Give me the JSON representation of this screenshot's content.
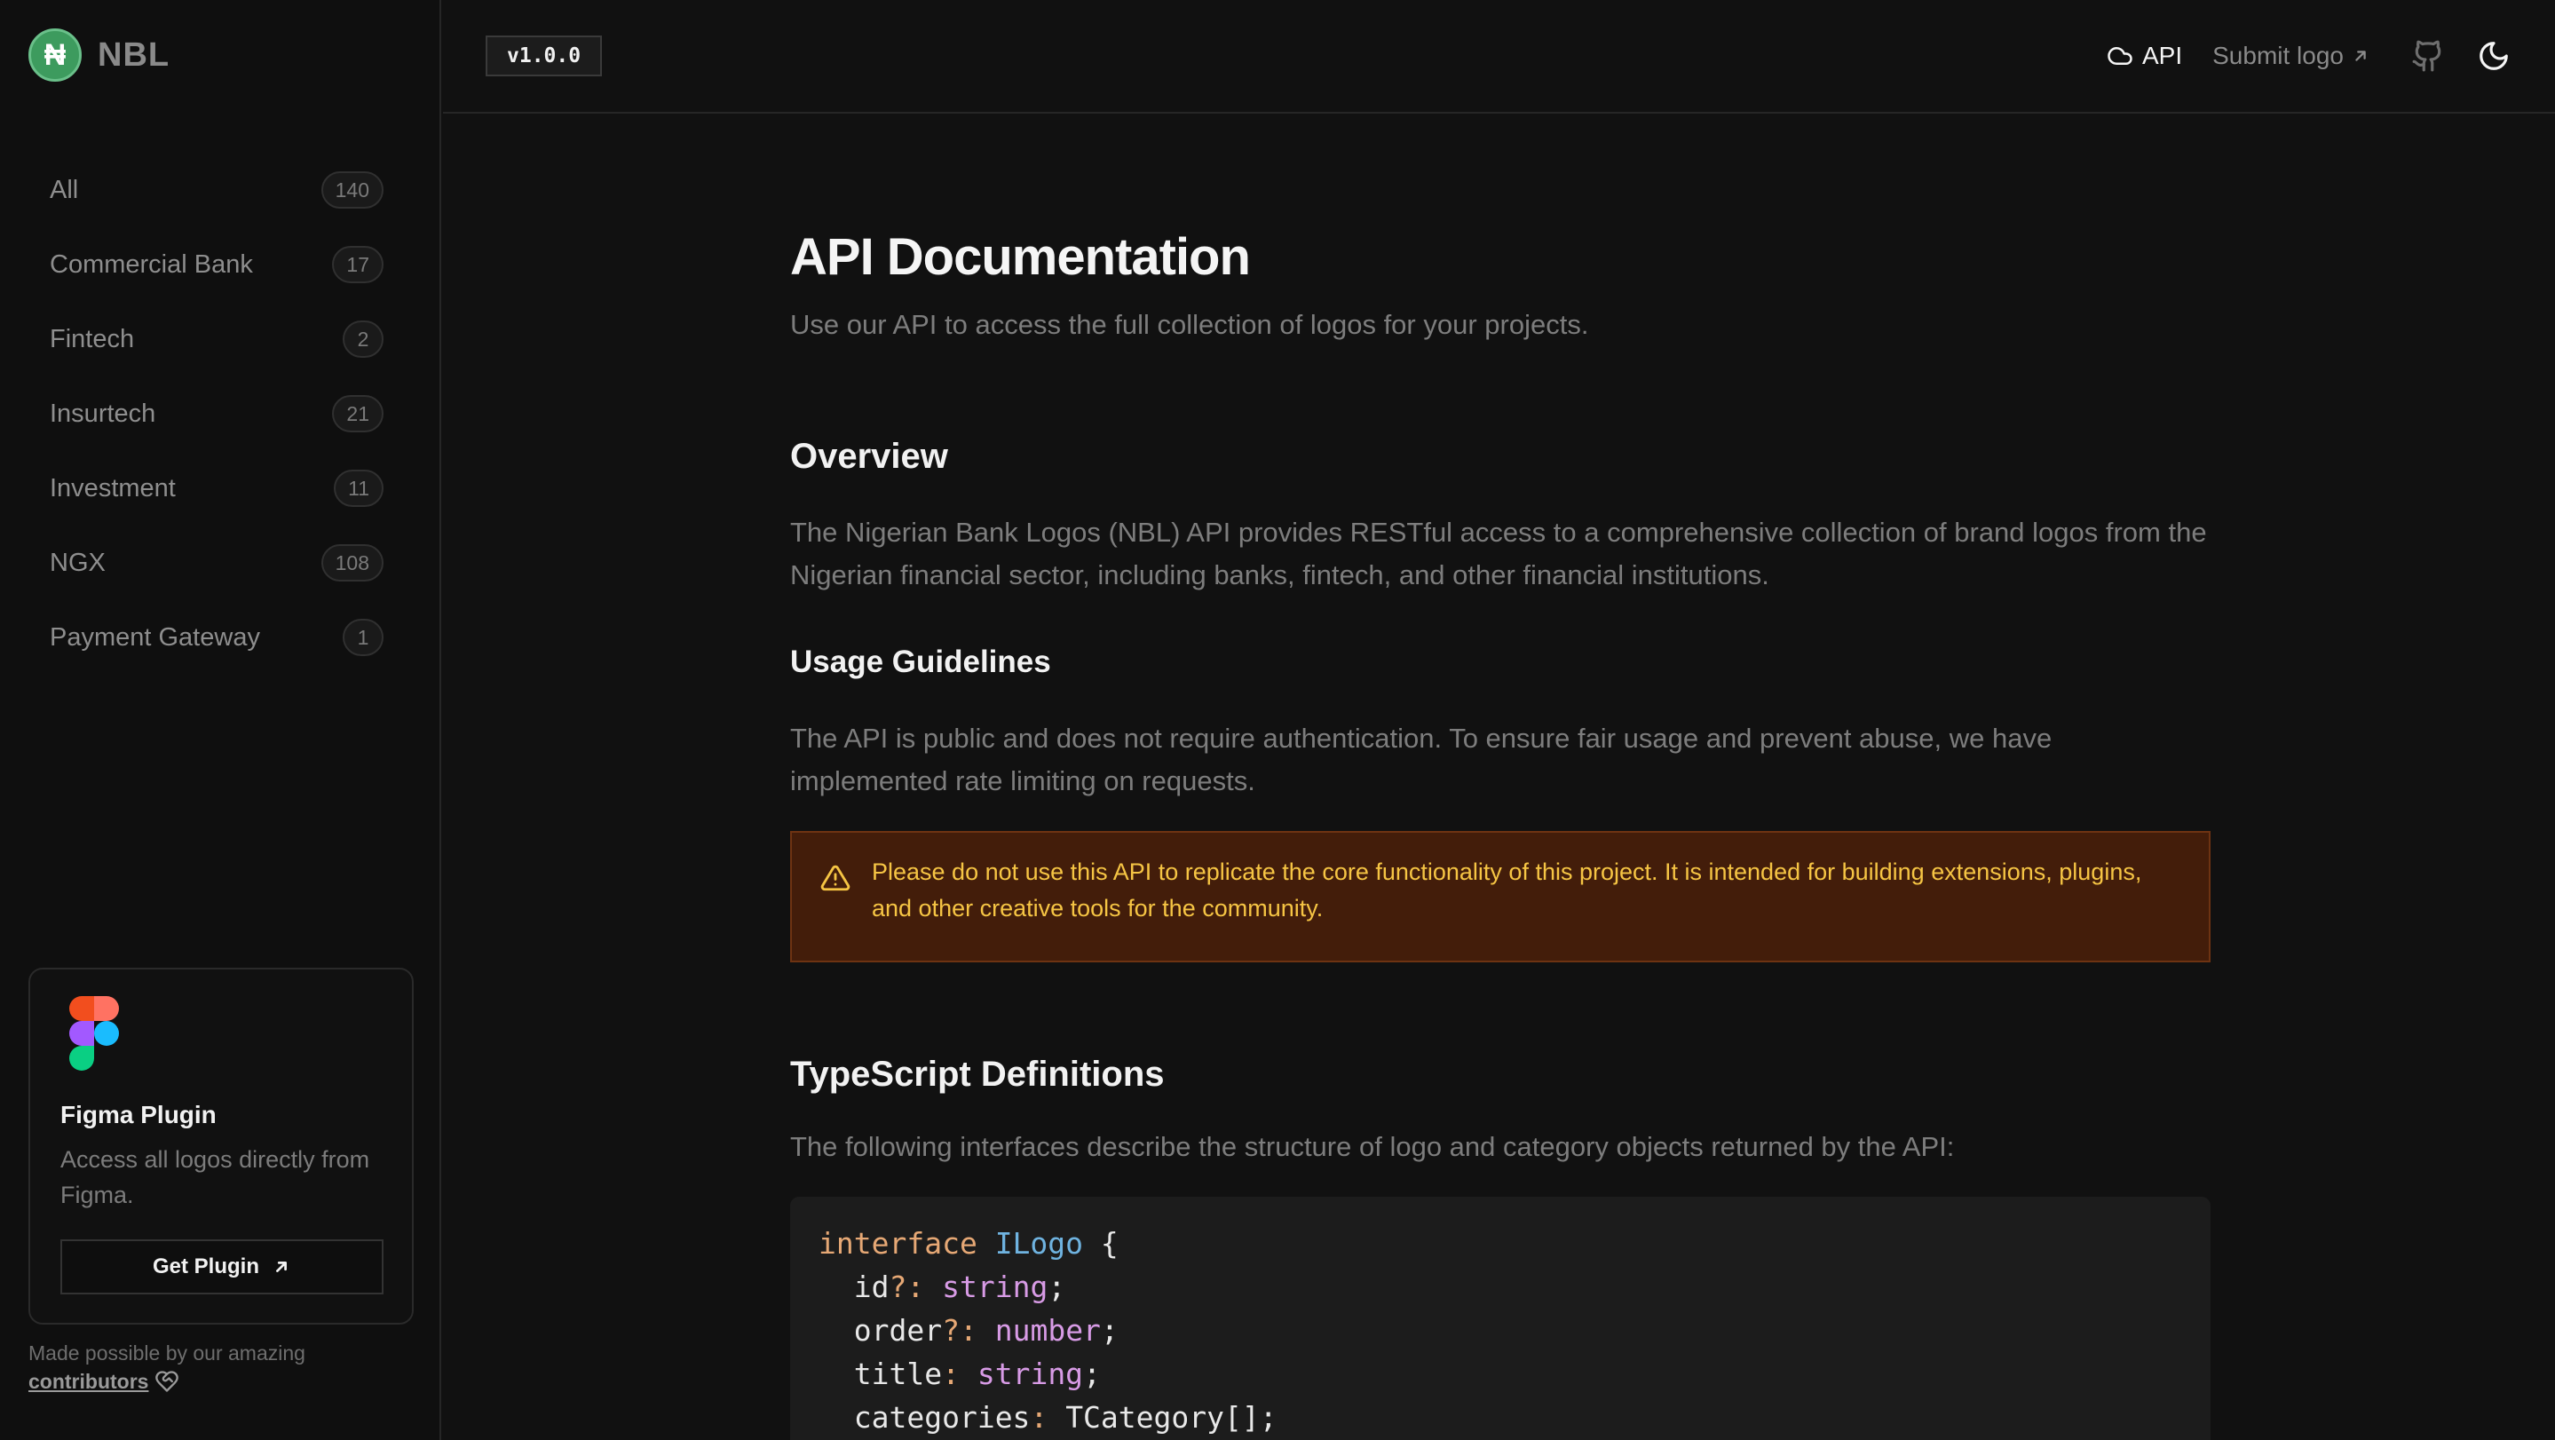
{
  "brand": {
    "glyph": "₦",
    "name": "NBL"
  },
  "categories": [
    {
      "label": "All",
      "count": "140"
    },
    {
      "label": "Commercial Bank",
      "count": "17"
    },
    {
      "label": "Fintech",
      "count": "2"
    },
    {
      "label": "Insurtech",
      "count": "21"
    },
    {
      "label": "Investment",
      "count": "11"
    },
    {
      "label": "NGX",
      "count": "108"
    },
    {
      "label": "Payment Gateway",
      "count": "1"
    }
  ],
  "plugin": {
    "title": "Figma Plugin",
    "description": "Access all logos directly from Figma.",
    "button_label": "Get Plugin"
  },
  "credits": {
    "text": "Made possible by our amazing",
    "link": "contributors"
  },
  "topbar": {
    "version": "v1.0.0",
    "api_label": "API",
    "submit_label": "Submit logo"
  },
  "main": {
    "title": "API Documentation",
    "lead": "Use our API to access the full collection of logos for your projects.",
    "overview_heading": "Overview",
    "overview_text": "The Nigerian Bank Logos (NBL) API provides RESTful access to a comprehensive collection of brand logos from the Nigerian financial sector, including banks, fintech, and other financial institutions.",
    "usage_heading": "Usage Guidelines",
    "usage_text": "The API is public and does not require authentication. To ensure fair usage and prevent abuse, we have implemented rate limiting on requests.",
    "warning_text": "Please do not use this API to replicate the core functionality of this project. It is intended for building extensions, plugins, and other creative tools for the community.",
    "ts_heading": "TypeScript Definitions",
    "ts_text": "The following interfaces describe the structure of logo and category objects returned by the API:"
  },
  "code": {
    "keyword": "interface",
    "interface_name": "ILogo",
    "open_brace": " {",
    "fields": [
      {
        "name": "id",
        "sep": "?:",
        "type": "string",
        "end": ";"
      },
      {
        "name": "order",
        "sep": "?:",
        "type": "number",
        "end": ";"
      },
      {
        "name": "title",
        "sep": ":",
        "type": "string",
        "end": ";"
      },
      {
        "name": "categories",
        "sep": ":",
        "type": "TCategory[]",
        "end": ";"
      }
    ]
  },
  "colors": {
    "background": "#111111",
    "brand_green": "#3d9b5e",
    "warning_bg": "#431d0a",
    "warning_text": "#f6c544"
  },
  "icons": {
    "brand": "naira-logo-icon",
    "api": "cloud-icon",
    "submit": "external-arrow-icon",
    "github": "github-icon",
    "theme": "moon-icon",
    "warning": "warning-triangle-icon",
    "plugin": "figma-logo-icon",
    "credits": "heart-handshake-icon"
  }
}
